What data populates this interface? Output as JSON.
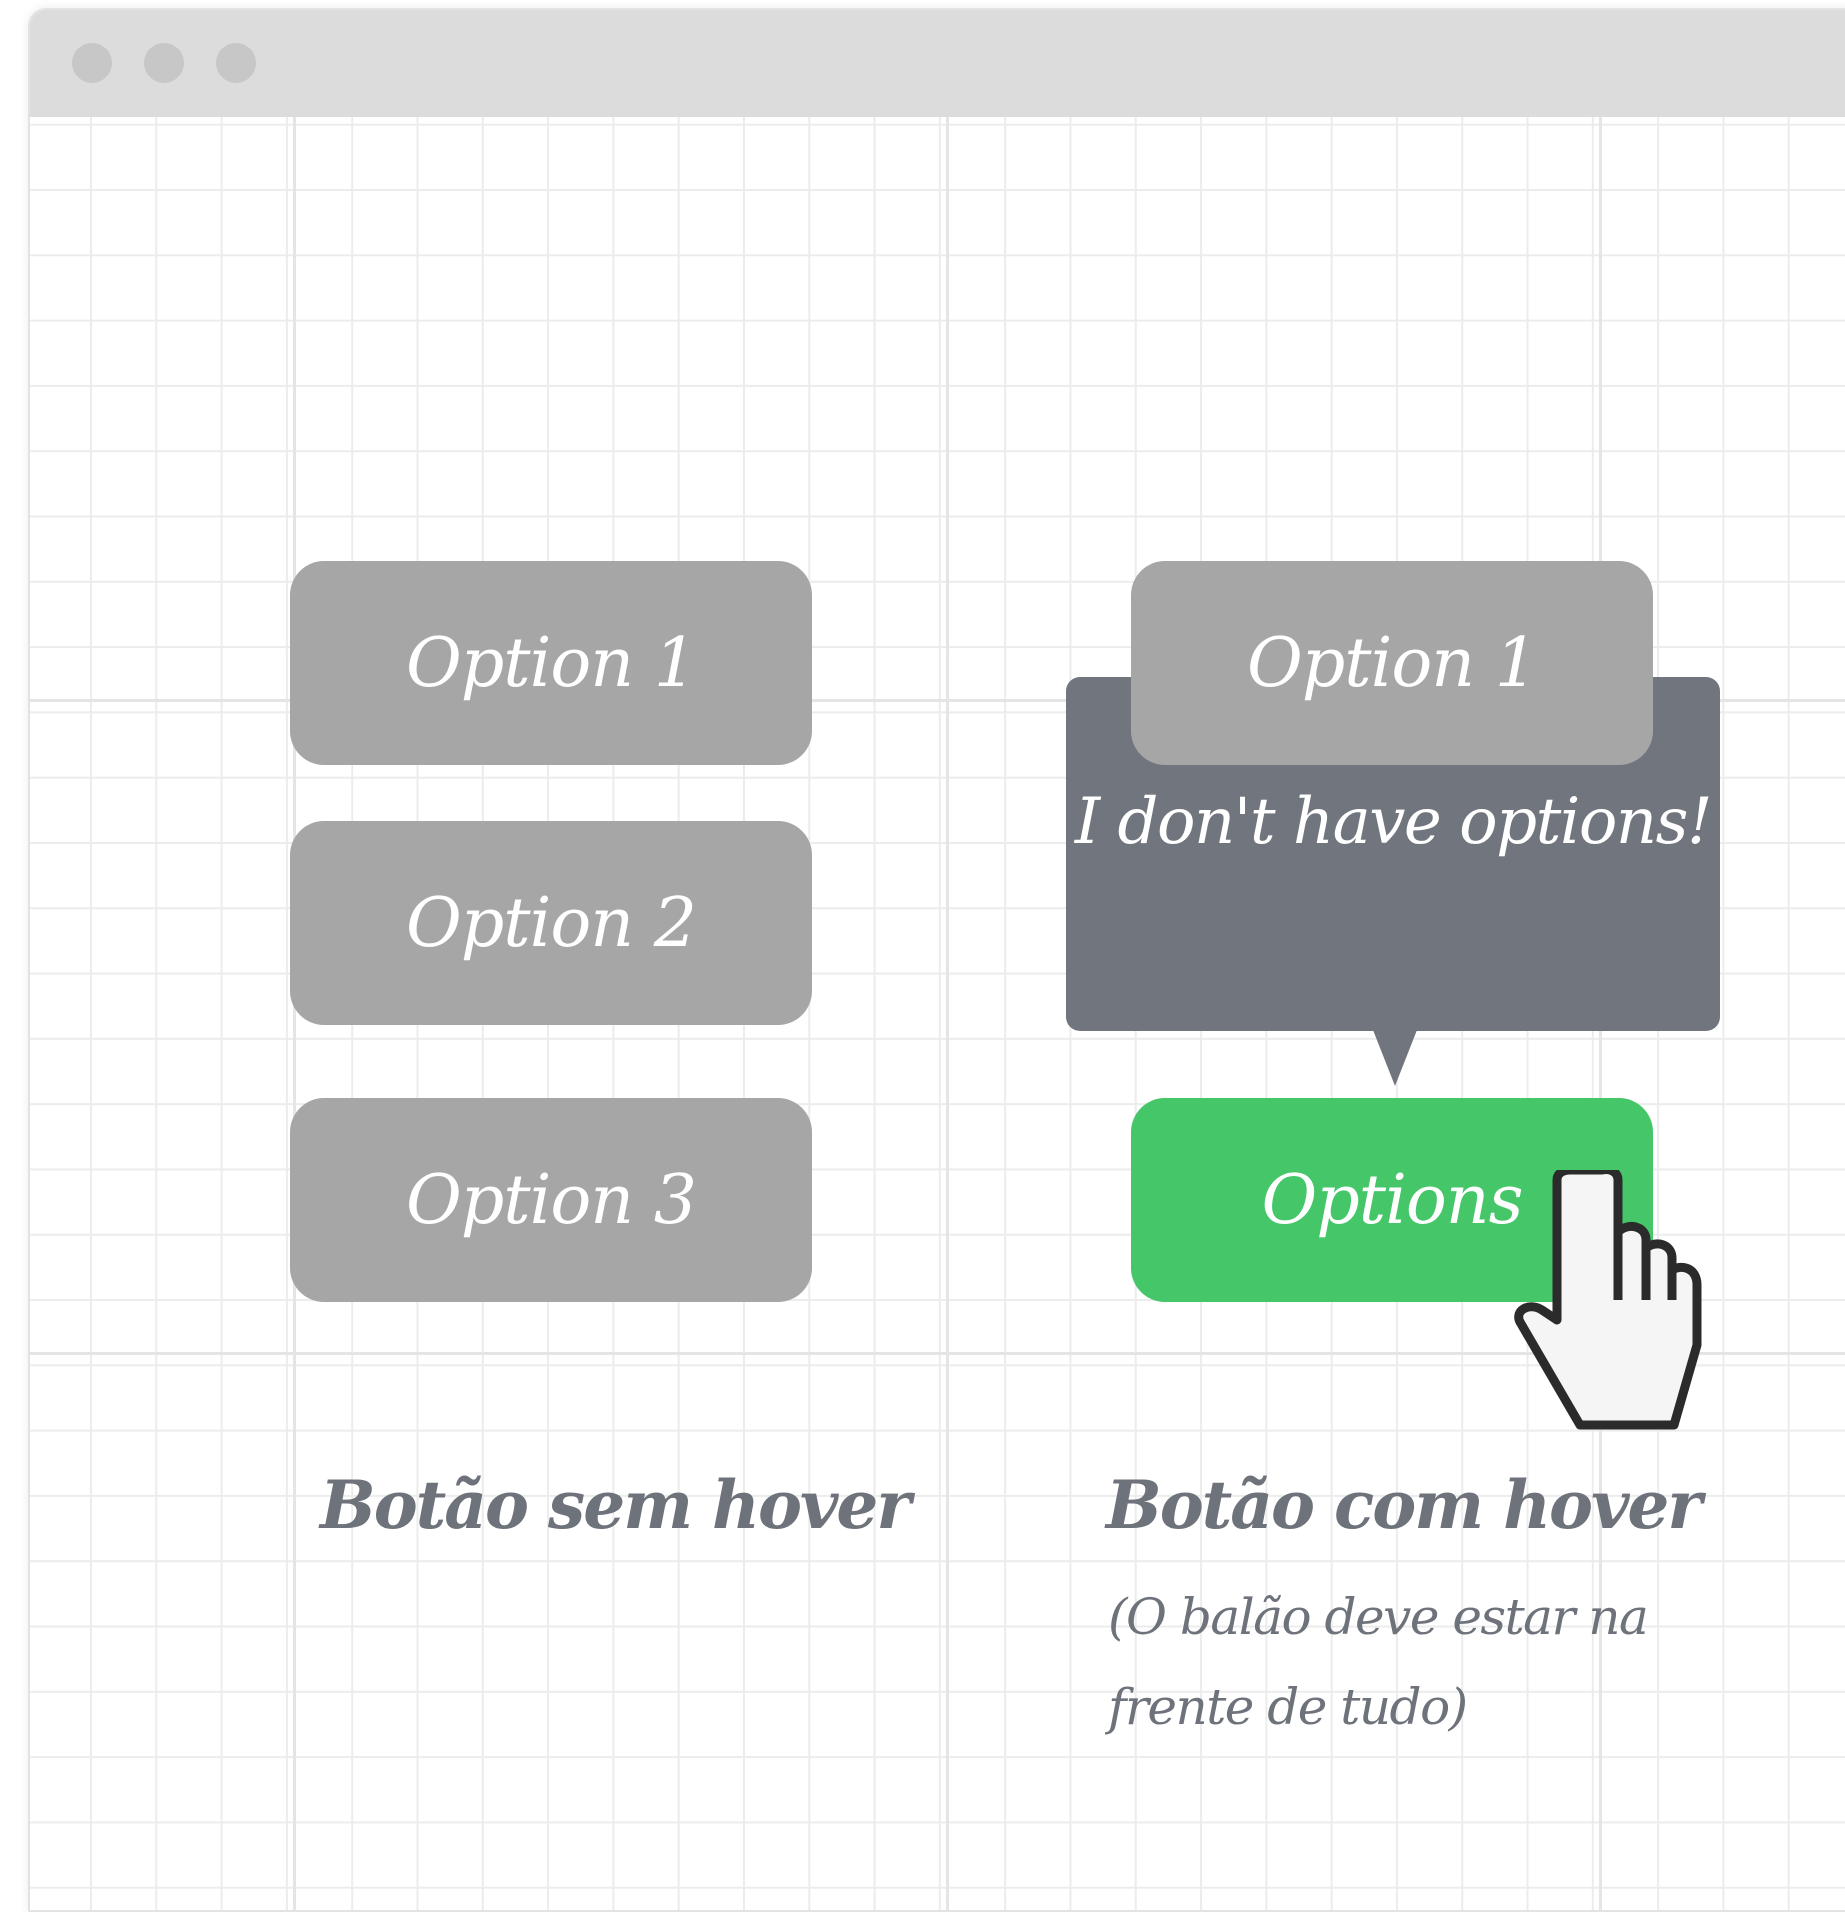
{
  "window": {
    "controls": [
      "window-dot-1",
      "window-dot-2",
      "window-dot-3"
    ]
  },
  "left_panel": {
    "buttons": [
      "Option 1",
      "Option 2",
      "Option 3"
    ],
    "caption": "Botão sem hover"
  },
  "right_panel": {
    "menu_item": "Option 1",
    "tooltip_text": "I don't have options!",
    "main_button": "Options",
    "caption": "Botão com hover",
    "note": "(O balão deve estar na frente de tudo)"
  },
  "colors": {
    "button_gray": "#a6a6a6",
    "button_green": "#44c669",
    "tooltip_bg": "#71757e",
    "caption_text": "#6e727b",
    "titlebar": "#dcdcdc",
    "grid_line": "#e5e5e5"
  },
  "icons": {
    "cursor": "pointer-hand-icon"
  }
}
